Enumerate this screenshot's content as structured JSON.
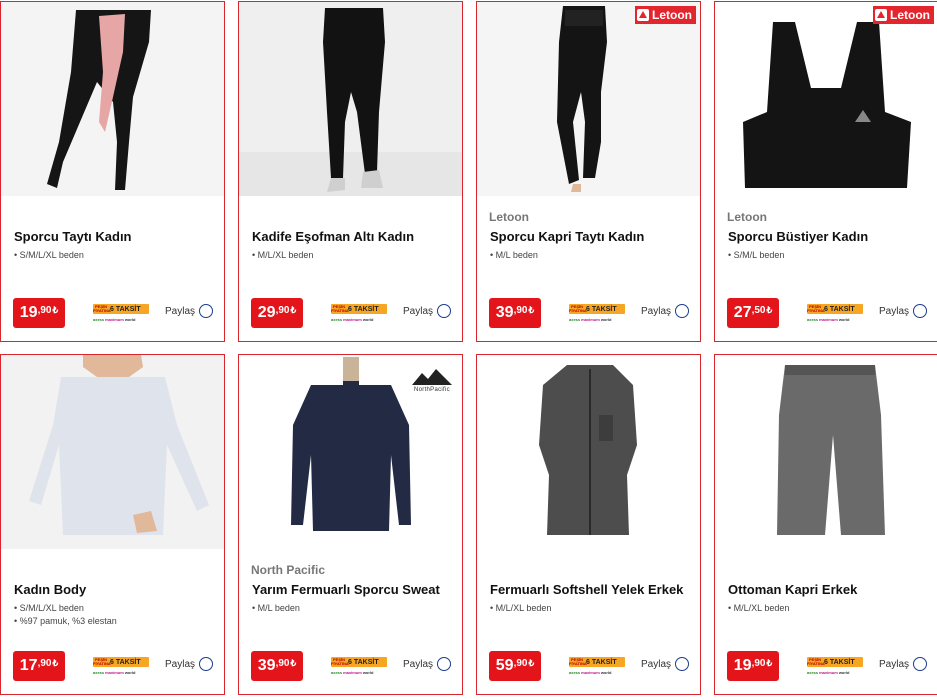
{
  "products": [
    {
      "brand": "",
      "name": "Sporcu Taytı Kadın",
      "details": [
        "• S/M/L/XL beden"
      ],
      "price_int": "19",
      "price_dec": ",90",
      "currency": "₺",
      "badge": ""
    },
    {
      "brand": "",
      "name": "Kadife Eşofman Altı Kadın",
      "details": [
        "• M/L/XL beden"
      ],
      "price_int": "29",
      "price_dec": ",90",
      "currency": "₺",
      "badge": ""
    },
    {
      "brand": "Letoon",
      "name": "Sporcu Kapri Taytı Kadın",
      "details": [
        "• M/L beden"
      ],
      "price_int": "39",
      "price_dec": ",90",
      "currency": "₺",
      "badge": "Letoon"
    },
    {
      "brand": "Letoon",
      "name": "Sporcu Büstiyer Kadın",
      "details": [
        "• S/M/L beden"
      ],
      "price_int": "27",
      "price_dec": ",50",
      "currency": "₺",
      "badge": "Letoon"
    },
    {
      "brand": "",
      "name": "Kadın Body",
      "details": [
        "• S/M/L/XL beden",
        "• %97 pamuk, %3 elestan"
      ],
      "price_int": "17",
      "price_dec": ",90",
      "currency": "₺",
      "badge": ""
    },
    {
      "brand": "North Pacific",
      "name": "Yarım Fermuarlı Sporcu Sweat",
      "details": [
        "• M/L beden"
      ],
      "price_int": "39",
      "price_dec": ",90",
      "currency": "₺",
      "badge": "NorthPacific"
    },
    {
      "brand": "",
      "name": "Fermuarlı Softshell Yelek Erkek",
      "details": [
        "• M/L/XL beden"
      ],
      "price_int": "59",
      "price_dec": ",90",
      "currency": "₺",
      "badge": ""
    },
    {
      "brand": "",
      "name": "Ottoman Kapri Erkek",
      "details": [
        "• M/L/XL beden"
      ],
      "price_int": "19",
      "price_dec": ",90",
      "currency": "₺",
      "badge": ""
    }
  ],
  "share_label": "Paylaş",
  "installment": {
    "pesin": "PEŞİN FİYATINA",
    "taksit": "6 TAKSİT",
    "cards": [
      "axess",
      "maximum",
      "world"
    ]
  },
  "colors": {
    "accent": "#e3151b",
    "border": "#d9262c",
    "share": "#1b3d8f",
    "installment": "#f6a623"
  }
}
